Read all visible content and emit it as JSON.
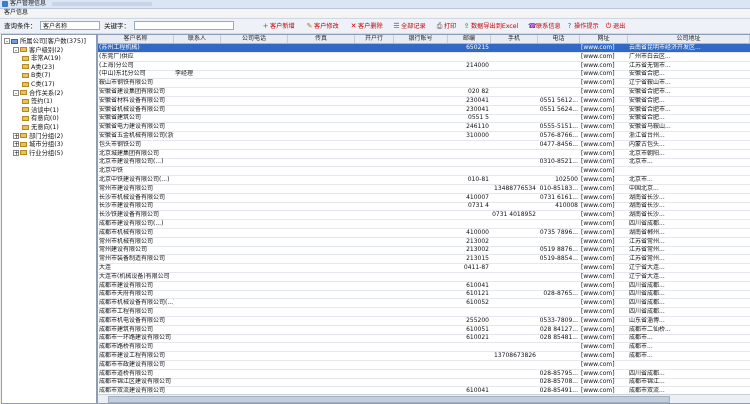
{
  "window": {
    "title": "客户管理信息"
  },
  "menu": {
    "label": "客户信息"
  },
  "toolbar": {
    "search_label": "查询条件：",
    "search_field": "客户名称",
    "keyword_label": "关键字：",
    "keyword_value": "",
    "buttons": [
      {
        "icon": "plus-icon",
        "label": "客户新增"
      },
      {
        "icon": "edit-icon",
        "label": "客户修改"
      },
      {
        "icon": "delete-icon",
        "label": "客户删除"
      },
      {
        "icon": "select-all-icon",
        "label": "全部记录"
      },
      {
        "icon": "print-icon",
        "label": "打印"
      },
      {
        "icon": "export-icon",
        "label": "数据导出到Excel"
      },
      {
        "icon": "contact-icon",
        "label": "联系信息"
      },
      {
        "icon": "help-icon",
        "label": "操作提示"
      },
      {
        "icon": "exit-icon",
        "label": "退出"
      }
    ]
  },
  "tree": [
    {
      "level": 0,
      "toggle": "-",
      "org": true,
      "label": "所属公司[客户数(375)]"
    },
    {
      "level": 1,
      "toggle": "-",
      "label": "客户级别(2)"
    },
    {
      "level": 2,
      "toggle": "",
      "label": "非常A(19)"
    },
    {
      "level": 2,
      "toggle": "",
      "label": "A类(23)"
    },
    {
      "level": 2,
      "toggle": "",
      "label": "B类(7)"
    },
    {
      "level": 2,
      "toggle": "",
      "label": "C类(17)"
    },
    {
      "level": 1,
      "toggle": "-",
      "label": "合作关系(2)"
    },
    {
      "level": 2,
      "toggle": "",
      "label": "签约(1)"
    },
    {
      "level": 2,
      "toggle": "",
      "label": "洽谈中(1)"
    },
    {
      "level": 2,
      "toggle": "",
      "label": "有意向(0)"
    },
    {
      "level": 2,
      "toggle": "",
      "label": "无意向(1)"
    },
    {
      "level": 1,
      "toggle": "+",
      "label": "部门分组(2)"
    },
    {
      "level": 1,
      "toggle": "+",
      "label": "城市分组(3)"
    },
    {
      "level": 1,
      "toggle": "+",
      "label": "行业分组(5)"
    }
  ],
  "grid": {
    "columns": [
      "客户名称",
      "联系人",
      "公司电话",
      "传真",
      "开户行",
      "银行账号",
      "邮编",
      "手机",
      "电话",
      "网址",
      "公司地址"
    ],
    "rows": [
      [
        "(苏州工程机械)",
        "",
        "",
        "",
        "",
        "",
        "650215",
        "",
        "",
        "[www.com]",
        "云南省昆明市经济开发区..."
      ],
      [
        "(东莞厂)供应",
        "",
        "",
        "",
        "",
        "",
        "",
        "",
        "",
        "[www.com]",
        "广州市白云区..."
      ],
      [
        "(上海)分公司",
        "",
        "",
        "",
        "",
        "",
        "214000",
        "",
        "",
        "[www.com]",
        "江苏省无锡市..."
      ],
      [
        "(中山)东北分公司",
        "李经理",
        "",
        "",
        "",
        "",
        "",
        "",
        "",
        "[www.com]",
        "安徽省合肥..."
      ],
      [
        "鞍山市钢铁有限公司",
        "",
        "",
        "",
        "",
        "",
        "",
        "",
        "",
        "[www.com]",
        "辽宁省鞍山市..."
      ],
      [
        "安徽省建设集团有限公司",
        "",
        "",
        "",
        "",
        "",
        "020 82",
        "",
        "",
        "[www.com]",
        "安徽省合肥市..."
      ],
      [
        "安徽省材料设备有限公司",
        "",
        "",
        "",
        "",
        "",
        "230041",
        "",
        "0551 5612...",
        "[www.com]",
        "安徽省合肥..."
      ],
      [
        "安徽省机械设备有限公司",
        "",
        "",
        "",
        "",
        "",
        "230041",
        "",
        "0551 5624...",
        "[www.com]",
        "安徽省合肥市..."
      ],
      [
        "安徽省建筑公司",
        "",
        "",
        "",
        "",
        "",
        "0551 5",
        "",
        "",
        "[www.com]",
        "安徽省合肥..."
      ],
      [
        "安徽省电力建设有限公司",
        "",
        "",
        "",
        "",
        "",
        "246110",
        "",
        "0555-5151...",
        "[www.com]",
        "安徽省马鞍山..."
      ],
      [
        "安徽省五金机械有限公司(浙江)",
        "",
        "",
        "",
        "",
        "",
        "310000",
        "",
        "0576-8766...",
        "[www.com]",
        "浙江省台州..."
      ],
      [
        "包头市钢铁公司",
        "",
        "",
        "",
        "",
        "",
        "",
        "",
        "0477-8456...",
        "[www.com]",
        "内蒙古包头..."
      ],
      [
        "北京城建集团有限公司",
        "",
        "",
        "",
        "",
        "",
        "",
        "",
        "",
        "[www.com]",
        "北京市朝阳..."
      ],
      [
        "北京市建设有限公司(...)",
        "",
        "",
        "",
        "",
        "",
        "",
        "",
        "0310-8521...",
        "[www.com]",
        "北京市..."
      ],
      [
        "北京中铁",
        "",
        "",
        "",
        "",
        "",
        "",
        "",
        "",
        "[www.com]",
        ""
      ],
      [
        "北京中铁建设有限公司(...)",
        "",
        "",
        "",
        "",
        "",
        "010-81",
        "",
        "102500",
        "[www.com]",
        "北京市..."
      ],
      [
        "常州市建设有限公司",
        "",
        "",
        "",
        "",
        "",
        "",
        "13488776534",
        "010-85183...",
        "[www.com]",
        "中国北京..."
      ],
      [
        "长沙市机械设备有限公司",
        "",
        "",
        "",
        "",
        "",
        "410007",
        "",
        "0731 6161...",
        "[www.com]",
        "湖南省长沙..."
      ],
      [
        "长沙市建设有限公司",
        "",
        "",
        "",
        "",
        "",
        "0731 4",
        "",
        "410008",
        "[www.com]",
        "湖南省长沙..."
      ],
      [
        "长沙铁建设备有限公司",
        "",
        "",
        "",
        "",
        "",
        "",
        "0731 4018952",
        "",
        "[www.com]",
        "湖南省长沙..."
      ],
      [
        "成都市建设有限公司(...)",
        "",
        "",
        "",
        "",
        "",
        "",
        "",
        "",
        "[www.com]",
        "四川省成都..."
      ],
      [
        "成都市机械有限公司",
        "",
        "",
        "",
        "",
        "",
        "410000",
        "",
        "0735 7896...",
        "[www.com]",
        "湖南省郴州..."
      ],
      [
        "常州市机械有限公司",
        "",
        "",
        "",
        "",
        "",
        "213002",
        "",
        "",
        "[www.com]",
        "江苏省常州..."
      ],
      [
        "常州建设有限公司",
        "",
        "",
        "",
        "",
        "",
        "213002",
        "",
        "0519 8876...",
        "[www.com]",
        "江苏省常州..."
      ],
      [
        "常州市装备制造有限公司",
        "",
        "",
        "",
        "",
        "",
        "213015",
        "",
        "0519-8854...",
        "[www.com]",
        "江苏省常州..."
      ],
      [
        "大连",
        "",
        "",
        "",
        "",
        "",
        "0411-87",
        "",
        "",
        "[www.com]",
        "辽宁省大连..."
      ],
      [
        "大连市(机械设备)有限公司",
        "",
        "",
        "",
        "",
        "",
        "",
        "",
        "",
        "[www.com]",
        "辽宁省大连..."
      ],
      [
        "成都市建设有限公司",
        "",
        "",
        "",
        "",
        "",
        "610041",
        "",
        "",
        "[www.com]",
        "四川省成都..."
      ],
      [
        "成都市天府有限公司",
        "",
        "",
        "",
        "",
        "",
        "610121",
        "",
        "028-8765...",
        "[www.com]",
        "四川省成都..."
      ],
      [
        "成都市机械设备有限公司(...)",
        "",
        "",
        "",
        "",
        "",
        "610052",
        "",
        "",
        "[www.com]",
        "四川省成都..."
      ],
      [
        "成都市工程有限公司",
        "",
        "",
        "",
        "",
        "",
        "",
        "",
        "",
        "[www.com]",
        "四川省成都..."
      ],
      [
        "成都市机电设备有限公司",
        "",
        "",
        "",
        "",
        "",
        "255200",
        "",
        "0533-7809...",
        "[www.com]",
        "山东省淄博..."
      ],
      [
        "成都市建筑有限公司",
        "",
        "",
        "",
        "",
        "",
        "610051",
        "",
        "028 84127...",
        "[www.com]",
        "成都市二仙桥..."
      ],
      [
        "成都市一环路建设有限公司",
        "",
        "",
        "",
        "",
        "",
        "610021",
        "",
        "028 85481...",
        "[www.com]",
        "成都市..."
      ],
      [
        "成都市路桥有限公司",
        "",
        "",
        "",
        "",
        "",
        "",
        "",
        "",
        "[www.com]",
        "成都市..."
      ],
      [
        "成都市建设工程有限公司",
        "",
        "",
        "",
        "",
        "",
        "",
        "13708673826",
        "",
        "[www.com]",
        "成都市..."
      ],
      [
        "成都市市政建设有限公司",
        "",
        "",
        "",
        "",
        "",
        "",
        "",
        "",
        "[www.com]",
        ""
      ],
      [
        "成都市道桥有限公司",
        "",
        "",
        "",
        "",
        "",
        "",
        "",
        "028-85795...",
        "[www.com]",
        "四川省成都..."
      ],
      [
        "成都市锦江区建设有限公司",
        "",
        "",
        "",
        "",
        "",
        "",
        "",
        "028-85708...",
        "[www.com]",
        "成都市锦江..."
      ],
      [
        "成都市双流建设有限公司",
        "",
        "",
        "",
        "",
        "",
        "610041",
        "",
        "028-85491...",
        "[www.com]",
        "成都市双流..."
      ]
    ]
  }
}
